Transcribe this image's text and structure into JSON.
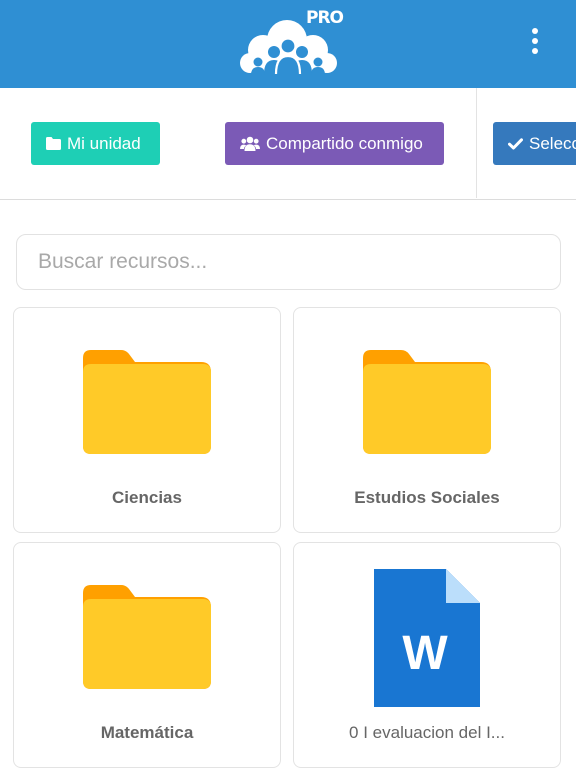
{
  "header": {
    "logo_badge": "PRO",
    "logo_icon": "cloud-people-logo",
    "menu_icon": "kebab-menu-icon",
    "color": "#2f8fd3"
  },
  "toolbar": {
    "buttons": [
      {
        "label": "Mi unidad",
        "icon": "folder-icon",
        "color": "#1ecfb5"
      },
      {
        "label": "Compartido conmigo",
        "icon": "users-icon",
        "color": "#7b5ab6"
      },
      {
        "label": "Selecc",
        "icon": "check-icon",
        "color": "#3579bd"
      }
    ]
  },
  "search": {
    "placeholder": "Buscar recursos...",
    "value": ""
  },
  "resources": [
    {
      "name": "Ciencias",
      "type": "folder",
      "icon": "folder-icon"
    },
    {
      "name": "Estudios Sociales",
      "type": "folder",
      "icon": "folder-icon"
    },
    {
      "name": "Matemática",
      "type": "folder",
      "icon": "folder-icon"
    },
    {
      "name": "0 I evaluacion del I...",
      "type": "document",
      "icon": "word-document-icon",
      "badge": "W"
    }
  ],
  "colors": {
    "folder_body": "#ffca28",
    "folder_tab": "#ffa000",
    "word_blue": "#1976d2",
    "word_fold": "#bbdefb"
  }
}
